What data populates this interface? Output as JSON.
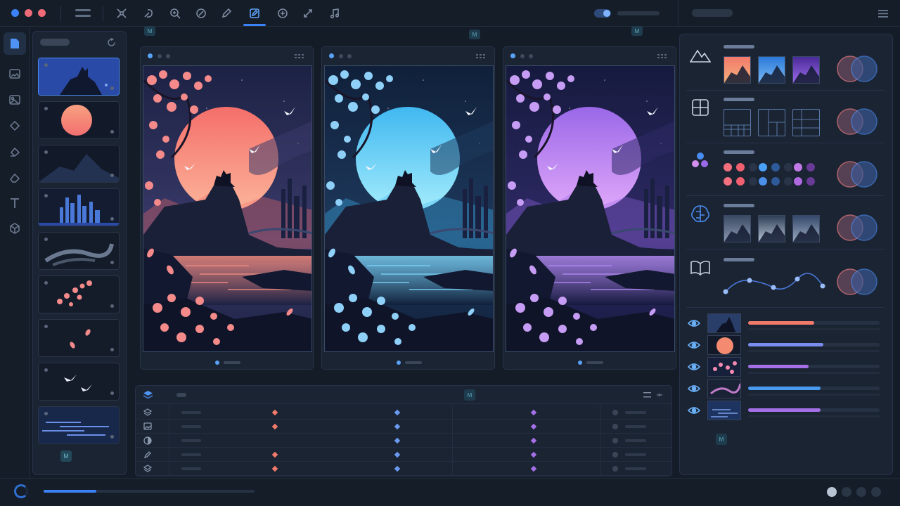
{
  "colors": {
    "accent": "#3b82f6",
    "warm": "#f27a6b",
    "cool": "#5ec2f2",
    "violet": "#a56fe8",
    "bg": "#141c28",
    "panel": "#1b2433"
  },
  "window": {
    "controls": [
      "window-dot-blue",
      "window-dot-red",
      "window-dot-red"
    ]
  },
  "toolbar": {
    "tools": [
      {
        "name": "select-icon"
      },
      {
        "name": "lasso-icon"
      },
      {
        "name": "zoom-icon"
      },
      {
        "name": "rotate-icon"
      },
      {
        "name": "pen-icon"
      },
      {
        "name": "edit-icon",
        "active": true
      },
      {
        "name": "add-icon"
      },
      {
        "name": "transform-icon"
      },
      {
        "name": "audio-icon"
      }
    ],
    "toggle_on": true
  },
  "left_rail": {
    "icons": [
      "file-icon",
      "image-icon",
      "gallery-icon",
      "shape-icon",
      "fill-icon",
      "eraser-icon",
      "text-icon",
      "cube-icon"
    ]
  },
  "layers_panel": {
    "badge": "M",
    "thumbs": [
      "wolf-layer",
      "moon-layer",
      "mountain-layer",
      "city-layer",
      "mist-layer",
      "blossom-layer",
      "petals-layer",
      "birds-layer",
      "water-layer"
    ]
  },
  "canvas": {
    "badge": "M",
    "variants": [
      {
        "name": "warm",
        "sky_top": "#1c2244",
        "sky_mid": "#3a3a6a",
        "moon_a": "#f46e6a",
        "moon_b": "#fcb49a",
        "water": "#f08a80",
        "blossom": "#f48a8a"
      },
      {
        "name": "cool",
        "sky_top": "#10203a",
        "sky_mid": "#1e3a5e",
        "moon_a": "#40b8f0",
        "moon_b": "#a4ecfc",
        "water": "#7ad0f6",
        "blossom": "#8ed0f8"
      },
      {
        "name": "violet",
        "sky_top": "#161a3e",
        "sky_mid": "#2e2a66",
        "moon_a": "#9a68e8",
        "moon_b": "#e0a8fa",
        "water": "#b088f0",
        "blossom": "#c79cf4"
      }
    ]
  },
  "timeline": {
    "badge": "M",
    "rows": [
      {
        "icon": "layers-icon",
        "keyframes": [
          true,
          true,
          true
        ]
      },
      {
        "icon": "image-icon",
        "keyframes": [
          true,
          true,
          true
        ]
      },
      {
        "icon": "contrast-icon",
        "keyframes": [
          false,
          true,
          true
        ]
      },
      {
        "icon": "pen-icon",
        "keyframes": [
          true,
          true,
          true
        ]
      },
      {
        "icon": "layers-alt-icon",
        "keyframes": [
          true,
          true,
          true
        ]
      }
    ]
  },
  "right_panel": {
    "sections": [
      {
        "icon": "mountain-icon",
        "kind": "scene-thumbs"
      },
      {
        "icon": "grid-icon",
        "kind": "layouts"
      },
      {
        "icon": "palette-icon",
        "kind": "color-swatches"
      },
      {
        "icon": "brain-icon",
        "kind": "style-thumbs"
      },
      {
        "icon": "book-icon",
        "kind": "curve"
      }
    ],
    "layer_levels": [
      {
        "name": "wolf",
        "color": "#f27a6b",
        "level": 0.5
      },
      {
        "name": "moon",
        "color": "#7a8cf0",
        "level": 0.57
      },
      {
        "name": "blossom",
        "color": "#a56fe8",
        "level": 0.46
      },
      {
        "name": "mist",
        "color": "#4a9af0",
        "level": 0.55
      },
      {
        "name": "water",
        "color": "#a56fe8",
        "level": 0.55
      }
    ],
    "badge": "M"
  },
  "status": {
    "progress": 0.25,
    "pager_count": 4,
    "pager_active": 0
  }
}
